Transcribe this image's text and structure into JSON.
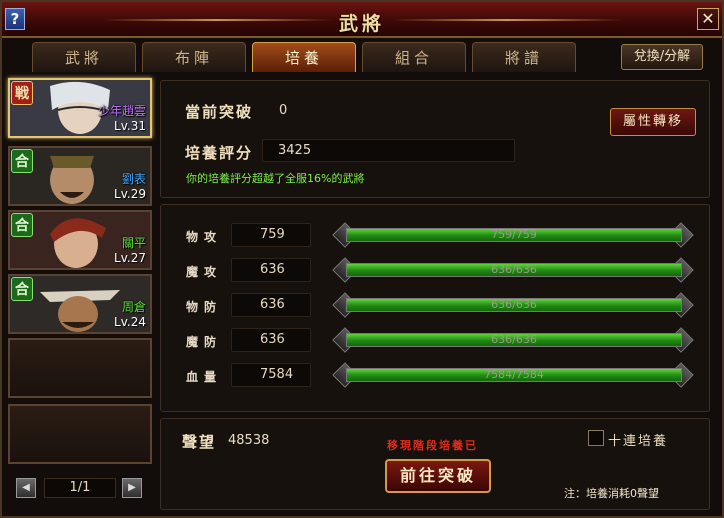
{
  "window": {
    "title": "武將",
    "help_glyph": "?",
    "close_glyph": "✕"
  },
  "tabs": [
    {
      "label": "武將",
      "active": false
    },
    {
      "label": "布陣",
      "active": false
    },
    {
      "label": "培養",
      "active": true
    },
    {
      "label": "組合",
      "active": false
    },
    {
      "label": "將譜",
      "active": false
    }
  ],
  "swap_button": "兌換/分解",
  "generals": [
    {
      "badge": "戦",
      "badge_type": "zhan",
      "name": "少年趙雲",
      "level": "Lv.31",
      "name_color": "#c070ff",
      "selected": true
    },
    {
      "badge": "合",
      "badge_type": "he",
      "name": "劉表",
      "level": "Lv.29",
      "name_color": "#3fa8ff",
      "selected": false
    },
    {
      "badge": "合",
      "badge_type": "he",
      "name": "關平",
      "level": "Lv.27",
      "name_color": "#5be03a",
      "selected": false
    },
    {
      "badge": "合",
      "badge_type": "he",
      "name": "周倉",
      "level": "Lv.24",
      "name_color": "#5be03a",
      "selected": false
    }
  ],
  "pager": {
    "text": "1/1",
    "prev": "◀",
    "next": "▶"
  },
  "cultivation": {
    "breakthrough_label": "當前突破",
    "breakthrough_value": "0",
    "score_label": "培養評分",
    "score_value": "3425",
    "message": "你的培養評分超越了全服16%的武將",
    "attr_button": "屬性轉移"
  },
  "stats": [
    {
      "label": "物攻",
      "value": "759",
      "current": 759,
      "max": 759,
      "bar_text": "759/759"
    },
    {
      "label": "魔攻",
      "value": "636",
      "current": 636,
      "max": 636,
      "bar_text": "636/636"
    },
    {
      "label": "物防",
      "value": "636",
      "current": 636,
      "max": 636,
      "bar_text": "636/636"
    },
    {
      "label": "魔防",
      "value": "636",
      "current": 636,
      "max": 636,
      "bar_text": "636/636"
    },
    {
      "label": "血量",
      "value": "7584",
      "current": 7584,
      "max": 7584,
      "bar_text": "7584/7584"
    }
  ],
  "bottom": {
    "reputation_label": "聲望",
    "reputation_value": "48538",
    "red_message": "移現階段培養已",
    "ten_label": "十連培養",
    "ten_checked": false,
    "go_button": "前往突破",
    "note": "注：培養消耗0聲望"
  },
  "colors": {
    "bar_green": "#3fb02a",
    "accent_red": "#7a1810",
    "gold": "#d49a48"
  }
}
